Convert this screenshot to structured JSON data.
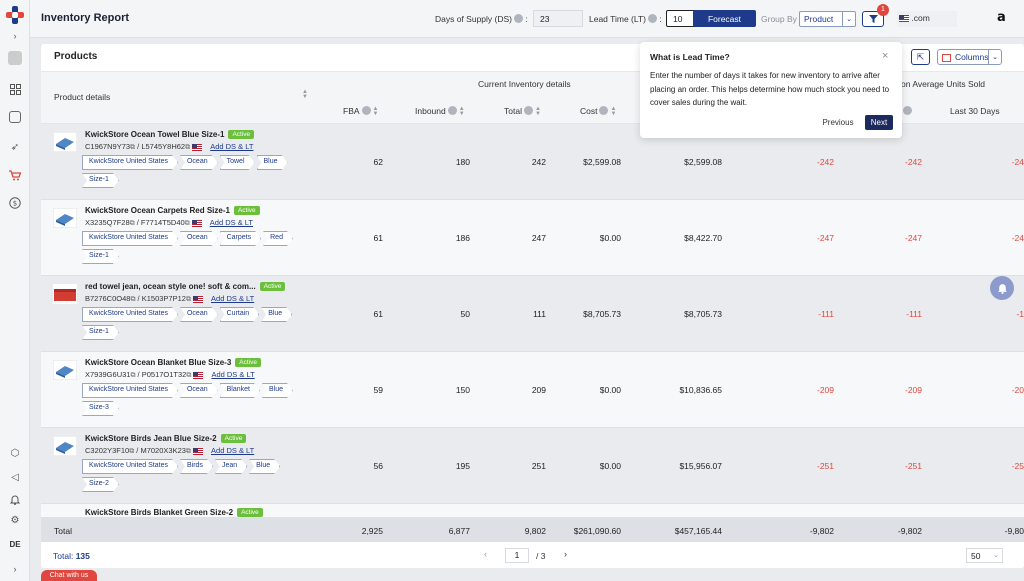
{
  "topbar": {
    "title": "Inventory Report",
    "ds_label": "Days of Supply (DS)",
    "ds_value": "23",
    "lt_label": "Lead Time (LT)",
    "lt_value": "10",
    "forecast_label": "Forecast",
    "groupby_label": "Group By",
    "groupby_value": "Product",
    "filter_count": "1",
    "marketplace": ".com"
  },
  "card": {
    "title": "Products",
    "columns_label": "Columns"
  },
  "table": {
    "product_details_header": "Product details",
    "current_inventory_group": "Current Inventory details",
    "average_units_group": "on Average Units Sold",
    "headers": {
      "fba": "FBA",
      "inbound": "Inbound",
      "total": "Total",
      "cost": "Cost",
      "last30": "Last 30 Days"
    },
    "add_ds_lt": "Add DS & LT",
    "rows": [
      {
        "name": "KwickStore Ocean Towel Blue Size-1",
        "status": "Active",
        "asin": "C1967N9Y73",
        "sku": "L5745Y8H62",
        "crumbs": [
          "KwickStore United States",
          "Ocean",
          "Towel",
          "Blue",
          "Size-1"
        ],
        "fba": "62",
        "inbound": "180",
        "total": "242",
        "cost": "$2,599.08",
        "value": "$2,599.08",
        "c1": "-242",
        "c2": "-242",
        "c3": "-24"
      },
      {
        "name": "KwickStore Ocean Carpets Red Size-1",
        "status": "Active",
        "asin": "X3235Q7F28",
        "sku": "F7714T5D40",
        "crumbs": [
          "KwickStore United States",
          "Ocean",
          "Carpets",
          "Red",
          "Size-1"
        ],
        "fba": "61",
        "inbound": "186",
        "total": "247",
        "cost": "$0.00",
        "value": "$8,422.70",
        "c1": "-247",
        "c2": "-247",
        "c3": "-24"
      },
      {
        "name": "red towel jean, ocean style one! soft & com...",
        "status": "Active",
        "asin": "B7276C0O48",
        "sku": "K1503P7P12",
        "crumbs": [
          "KwickStore United States",
          "Ocean",
          "Curtain",
          "Blue",
          "Size-1"
        ],
        "fba": "61",
        "inbound": "50",
        "total": "111",
        "cost": "$8,705.73",
        "value": "$8,705.73",
        "c1": "-111",
        "c2": "-111",
        "c3": "-1"
      },
      {
        "name": "KwickStore Ocean Blanket Blue Size-3",
        "status": "Active",
        "asin": "X7939G6U31",
        "sku": "P0517O1T32",
        "crumbs": [
          "KwickStore United States",
          "Ocean",
          "Blanket",
          "Blue",
          "Size-3"
        ],
        "fba": "59",
        "inbound": "150",
        "total": "209",
        "cost": "$0.00",
        "value": "$10,836.65",
        "c1": "-209",
        "c2": "-209",
        "c3": "-20"
      },
      {
        "name": "KwickStore Birds Jean Blue Size-2",
        "status": "Active",
        "asin": "C3202Y3F10",
        "sku": "M7020X3K23",
        "crumbs": [
          "KwickStore United States",
          "Birds",
          "Jean",
          "Blue",
          "Size-2"
        ],
        "fba": "56",
        "inbound": "195",
        "total": "251",
        "cost": "$0.00",
        "value": "$15,956.07",
        "c1": "-251",
        "c2": "-251",
        "c3": "-25"
      },
      {
        "name": "KwickStore Birds Blanket Green Size-2",
        "status": "Active"
      }
    ],
    "totals": {
      "label": "Total",
      "fba": "2,925",
      "inbound": "6,877",
      "total": "9,802",
      "cost": "$261,090.60",
      "value": "$457,165.44",
      "c1": "-9,802",
      "c2": "-9,802",
      "c3": "-9,80"
    }
  },
  "pager": {
    "total_label": "Total:",
    "total_value": "135",
    "page": "1",
    "of_pages": "/  3",
    "page_size": "50"
  },
  "tooltip": {
    "title": "What is Lead Time?",
    "body": "Enter the number of days it takes for new inventory to arrive after placing an order. This helps determine how much stock you need to cover sales during the wait.",
    "prev": "Previous",
    "next": "Next"
  },
  "rail": {
    "lang": "DE"
  },
  "chat_label": "Chat with us",
  "colors": {
    "accent": "#1e3a8a",
    "negative": "#e0483f",
    "active_badge": "#6bbf3b"
  }
}
